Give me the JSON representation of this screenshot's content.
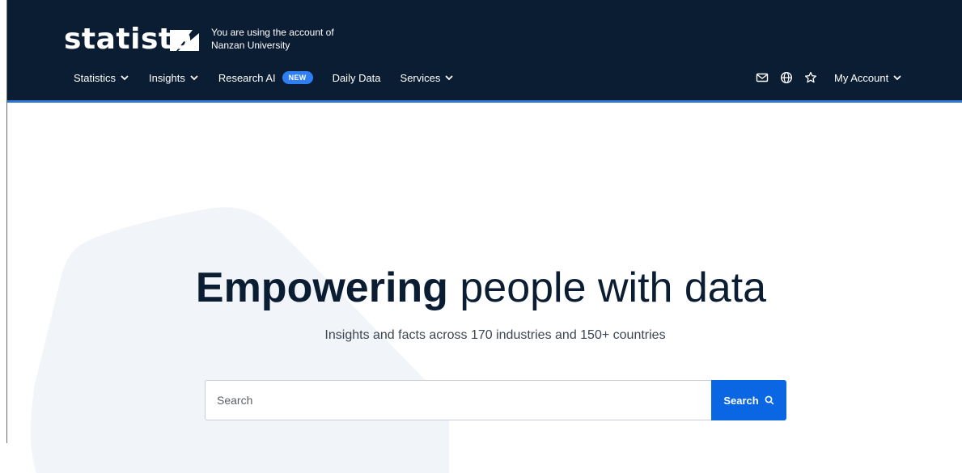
{
  "header": {
    "logo_text": "statista",
    "account_line1": "You are using the account of",
    "account_line2": "Nanzan University",
    "nav": {
      "statistics": "Statistics",
      "insights": "Insights",
      "research_ai": "Research AI",
      "new_badge": "NEW",
      "daily_data": "Daily Data",
      "services": "Services"
    },
    "icons": [
      "mail-icon",
      "globe-icon",
      "star-icon"
    ],
    "my_account": "My Account"
  },
  "hero": {
    "title_bold": "Empowering",
    "title_rest": " people with data",
    "subtitle": "Insights and facts across 170 industries and 150+ countries"
  },
  "search": {
    "placeholder": "Search",
    "value": "",
    "button_label": "Search"
  },
  "colors": {
    "header_bg": "#0b1d33",
    "accent": "#2f78d4",
    "button": "#0a66e2",
    "badge": "#2f7ef3"
  }
}
